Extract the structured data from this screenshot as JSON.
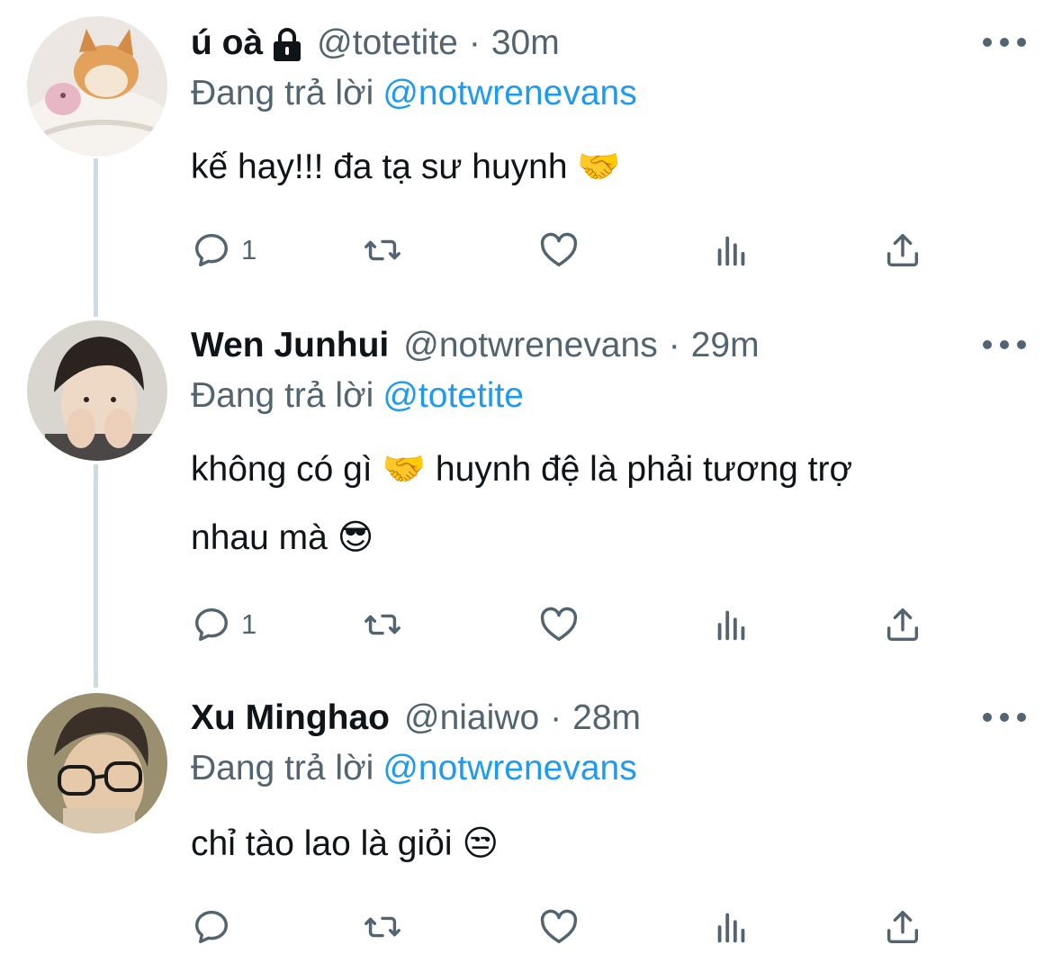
{
  "tweets": [
    {
      "name": "ú oà",
      "locked": true,
      "handle": "@totetite",
      "separator": "·",
      "time": "30m",
      "replying_prefix": "Đang trả lời",
      "replying_to": "@notwrenevans",
      "text_lines": [
        "kế hay!!! đa tạ sư huynh 🤝"
      ],
      "reply_count": "1"
    },
    {
      "name": "Wen Junhui",
      "locked": false,
      "handle": "@notwrenevans",
      "separator": "·",
      "time": "29m",
      "replying_prefix": "Đang trả lời",
      "replying_to": "@totetite",
      "text_lines": [
        "không có gì 🤝 huynh đệ là phải tương trợ",
        "nhau mà 😎"
      ],
      "reply_count": "1"
    },
    {
      "name": "Xu Minghao",
      "locked": false,
      "handle": "@niaiwo",
      "separator": "·",
      "time": "28m",
      "replying_prefix": "Đang trả lời",
      "replying_to": "@notwrenevans",
      "text_lines": [
        "chỉ tào lao là giỏi 😒"
      ],
      "reply_count": ""
    }
  ],
  "icons": {
    "reply": "reply-icon",
    "retweet": "retweet-icon",
    "like": "like-icon",
    "analytics": "analytics-icon",
    "share": "share-icon",
    "more": "more-icon",
    "lock": "lock-icon"
  },
  "colors": {
    "text": "#0f1419",
    "secondary": "#536471",
    "link": "#1d9bf0",
    "thread_line": "#cfd9de"
  }
}
